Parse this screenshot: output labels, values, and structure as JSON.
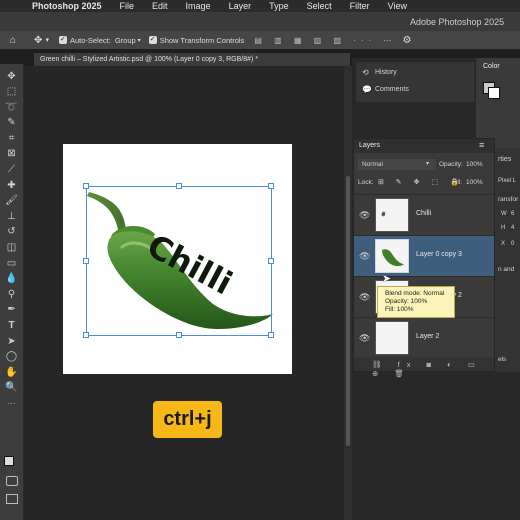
{
  "menubar": {
    "app_name": "Photoshop 2025",
    "items": [
      "File",
      "Edit",
      "Image",
      "Layer",
      "Type",
      "Select",
      "Filter",
      "View"
    ]
  },
  "titlebar": {
    "title": "Adobe Photoshop 2025"
  },
  "options": {
    "auto_select_label": "Auto-Select:",
    "auto_select_value": "Group",
    "show_transform_label": "Show Transform Controls"
  },
  "document": {
    "tab_title": "Green chilli – Stylized Artistic.psd @ 100% (Layer 0 copy 3, RGB/8#) *",
    "overlay_text": "Chilli"
  },
  "shortcut_badge": "ctrl+j",
  "panels": {
    "history_label": "History",
    "comments_label": "Comments",
    "color_label": "Color",
    "properties_fragment": "rties",
    "pixel_fragment": "Pixel L",
    "transform_fragment": "ransfor",
    "align_fragment": "n and",
    "els_fragment": "els",
    "w_label": "W",
    "h_label": "H",
    "x_label": "X",
    "w_val": "6",
    "h_val": "4",
    "x_val": "0"
  },
  "layers": {
    "panel_title": "Layers",
    "blend_mode": "Normal",
    "opacity_label": "Opacity:",
    "opacity_value": "100%",
    "lock_label": "Lock:",
    "fill_label": "Fill:",
    "fill_value": "100%",
    "items": [
      {
        "name": "Chilli",
        "selected": false
      },
      {
        "name": "Layer 0 copy 3",
        "selected": true
      },
      {
        "name": "Layer 0 copy 2",
        "selected": false,
        "partially_hidden": true
      },
      {
        "name": "Layer 2",
        "selected": false
      }
    ]
  },
  "tooltip": {
    "line1": "Blend mode: Normal",
    "line2": "Opacity: 100%",
    "line3": "Fill: 100%"
  },
  "colors": {
    "selection": "#4b8edb",
    "badge": "#f6b817",
    "selected_row": "#3f5e7e",
    "tooltip_bg": "#fbf3b8"
  }
}
